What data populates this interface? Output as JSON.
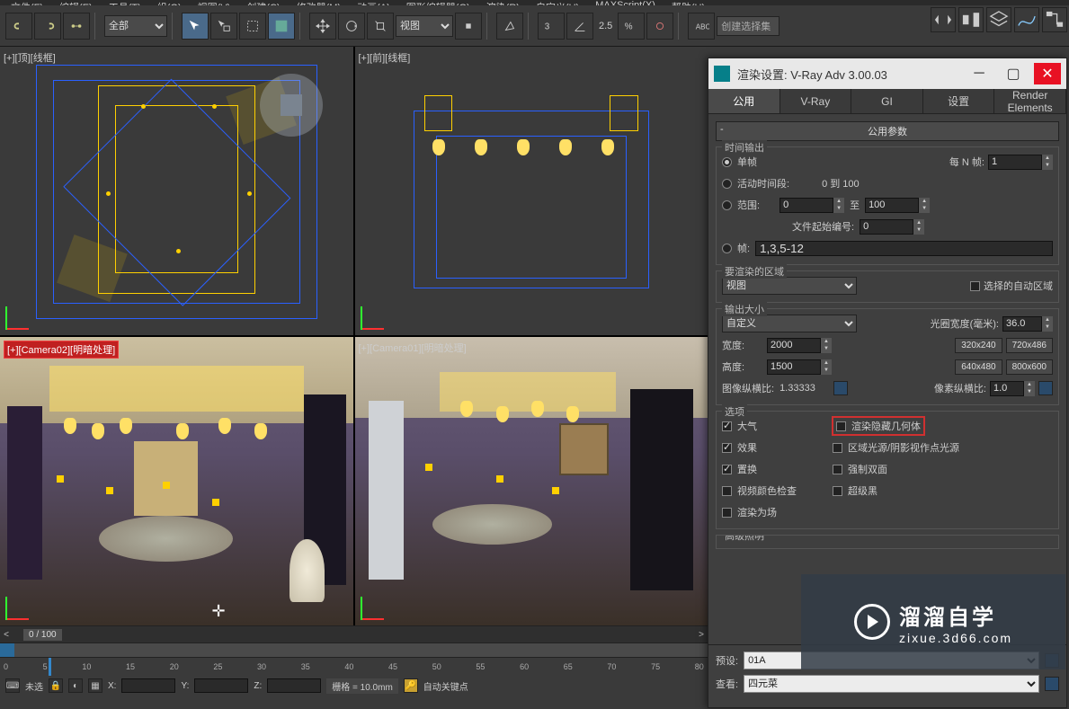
{
  "menubar": [
    "文件(F)",
    "编辑(E)",
    "工具(T)",
    "组(G)",
    "视图(V)",
    "创建(C)",
    "修改器(M)",
    "动画(A)",
    "图形编辑器(G)",
    "渲染(R)",
    "自定义(U)",
    "MAXScript(X)",
    "帮助(H)"
  ],
  "toolbar": {
    "selection_filter": "全部",
    "coord_system": "视图",
    "snap_value": "2.5",
    "named_set_placeholder": "创建选择集"
  },
  "viewports": {
    "top": "[+][顶][线框]",
    "front": "[+][前][线框]",
    "cam2": "[+][Camera02][明暗处理]",
    "cam1": "[+][Camera01][明暗处理]"
  },
  "timeline": {
    "frame_indicator": "0 / 100",
    "ticks": [
      "0",
      "5",
      "10",
      "15",
      "20",
      "25",
      "30",
      "35",
      "40",
      "45",
      "50",
      "55",
      "60",
      "65",
      "70",
      "75",
      "80"
    ],
    "status_prefix": "未选",
    "x_label": "X:",
    "y_label": "Y:",
    "z_label": "Z:",
    "grid": "栅格 = 10.0mm",
    "autokey_label": "自动关键点"
  },
  "render": {
    "title": "渲染设置: V-Ray Adv 3.00.03",
    "tabs": [
      "公用",
      "V-Ray",
      "GI",
      "设置",
      "Render Elements"
    ],
    "rollout1": "公用参数",
    "time": {
      "legend": "时间输出",
      "single": "单帧",
      "every_n_label": "每 N 帧:",
      "every_n_val": "1",
      "active_seg": "活动时间段:",
      "active_seg_val": "0 到 100",
      "range": "范围:",
      "range_from": "0",
      "range_to_lbl": "至",
      "range_to": "100",
      "file_start_lbl": "文件起始编号:",
      "file_start_val": "0",
      "frames": "帧:",
      "frames_val": "1,3,5-12"
    },
    "area": {
      "legend": "要渲染的区域",
      "view": "视图",
      "auto_region": "选择的自动区域"
    },
    "output": {
      "legend": "输出大小",
      "preset": "自定义",
      "aperture_lbl": "光圈宽度(毫米):",
      "aperture_val": "36.0",
      "width_lbl": "宽度:",
      "width_val": "2000",
      "height_lbl": "高度:",
      "height_val": "1500",
      "p1": "320x240",
      "p2": "720x486",
      "p3": "640x480",
      "p4": "800x600",
      "aspect_lbl": "图像纵横比:",
      "aspect_val": "1.33333",
      "pixel_aspect_lbl": "像素纵横比:",
      "pixel_aspect_val": "1.0"
    },
    "options": {
      "legend": "选项",
      "atm": "大气",
      "hidden": "渲染隐藏几何体",
      "fx": "效果",
      "arealight": "区域光源/阴影视作点光源",
      "disp": "置换",
      "force2": "强制双面",
      "videocolor": "视频颜色检查",
      "superblack": "超级黑",
      "render2f": "渲染为场"
    },
    "advlight": "高级照明",
    "bottom": {
      "preset_lbl": "预设:",
      "preset_val": "01A",
      "view_lbl": "查看:",
      "view_val": "四元菜"
    }
  },
  "watermark": {
    "big": "溜溜自学",
    "small": "zixue.3d66.com"
  }
}
